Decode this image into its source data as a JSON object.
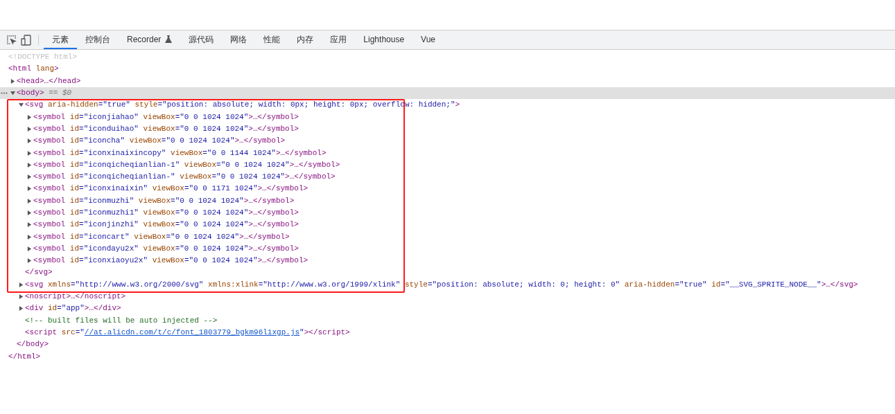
{
  "toolbar": {
    "tabs": [
      {
        "label": "元素",
        "kind": "plain",
        "selected": true
      },
      {
        "label": "控制台",
        "kind": "plain",
        "selected": false
      },
      {
        "label": "Recorder",
        "kind": "experimental",
        "selected": false
      },
      {
        "label": "源代码",
        "kind": "plain",
        "selected": false
      },
      {
        "label": "网络",
        "kind": "plain",
        "selected": false
      },
      {
        "label": "性能",
        "kind": "plain",
        "selected": false
      },
      {
        "label": "内存",
        "kind": "plain",
        "selected": false
      },
      {
        "label": "应用",
        "kind": "plain",
        "selected": false
      },
      {
        "label": "Lighthouse",
        "kind": "plain",
        "selected": false
      },
      {
        "label": "Vue",
        "kind": "plain",
        "selected": false
      }
    ]
  },
  "tree": [
    {
      "selected": false,
      "line": [
        {
          "kind": "doctype",
          "text": "<!DOCTYPE html>"
        }
      ]
    },
    {
      "selected": false,
      "line": [
        {
          "kind": "tag",
          "text": "<html"
        },
        {
          "kind": "attr",
          "text": " lang"
        },
        {
          "kind": "tag",
          "text": ">"
        }
      ],
      "close": [
        {
          "kind": "tag",
          "text": "</html>"
        }
      ],
      "children": [
        {
          "selected": false,
          "expanded": false,
          "line": [
            {
              "kind": "tag",
              "text": "<head>…</head>"
            }
          ]
        },
        {
          "selected": true,
          "expanded": true,
          "line": [
            {
              "kind": "tag",
              "text": "<body>"
            },
            {
              "kind": "ref",
              "text": " == $0"
            }
          ],
          "close": [
            {
              "kind": "tag",
              "text": "</body>"
            }
          ],
          "children": [
            {
              "selected": false,
              "expanded": true,
              "line": [
                {
                  "kind": "tag",
                  "text": "<svg"
                },
                {
                  "kind": "attr",
                  "text": " aria-hidden"
                },
                {
                  "kind": "value",
                  "text": "=\"true\""
                },
                {
                  "kind": "attr",
                  "text": " style"
                },
                {
                  "kind": "value",
                  "text": "=\"position: absolute; width: 0px; height: 0px; overflow: hidden;\""
                },
                {
                  "kind": "tag",
                  "text": ">"
                }
              ],
              "close": [
                {
                  "kind": "tag",
                  "text": "</svg>"
                }
              ],
              "children": [
                {
                  "selected": false,
                  "expanded": false,
                  "line": [
                    {
                      "kind": "tag",
                      "text": "<symbol"
                    },
                    {
                      "kind": "attr",
                      "text": " id"
                    },
                    {
                      "kind": "value",
                      "text": "=\"iconjiahao\""
                    },
                    {
                      "kind": "attr",
                      "text": " viewBox"
                    },
                    {
                      "kind": "value",
                      "text": "=\"0 0 1024 1024\""
                    },
                    {
                      "kind": "tag",
                      "text": ">…</symbol>"
                    }
                  ]
                },
                {
                  "selected": false,
                  "expanded": false,
                  "line": [
                    {
                      "kind": "tag",
                      "text": "<symbol"
                    },
                    {
                      "kind": "attr",
                      "text": " id"
                    },
                    {
                      "kind": "value",
                      "text": "=\"iconduihao\""
                    },
                    {
                      "kind": "attr",
                      "text": " viewBox"
                    },
                    {
                      "kind": "value",
                      "text": "=\"0 0 1024 1024\""
                    },
                    {
                      "kind": "tag",
                      "text": ">…</symbol>"
                    }
                  ]
                },
                {
                  "selected": false,
                  "expanded": false,
                  "line": [
                    {
                      "kind": "tag",
                      "text": "<symbol"
                    },
                    {
                      "kind": "attr",
                      "text": " id"
                    },
                    {
                      "kind": "value",
                      "text": "=\"iconcha\""
                    },
                    {
                      "kind": "attr",
                      "text": " viewBox"
                    },
                    {
                      "kind": "value",
                      "text": "=\"0 0 1024 1024\""
                    },
                    {
                      "kind": "tag",
                      "text": ">…</symbol>"
                    }
                  ]
                },
                {
                  "selected": false,
                  "expanded": false,
                  "line": [
                    {
                      "kind": "tag",
                      "text": "<symbol"
                    },
                    {
                      "kind": "attr",
                      "text": " id"
                    },
                    {
                      "kind": "value",
                      "text": "=\"iconxinaixincopy\""
                    },
                    {
                      "kind": "attr",
                      "text": " viewBox"
                    },
                    {
                      "kind": "value",
                      "text": "=\"0 0 1144 1024\""
                    },
                    {
                      "kind": "tag",
                      "text": ">…</symbol>"
                    }
                  ]
                },
                {
                  "selected": false,
                  "expanded": false,
                  "line": [
                    {
                      "kind": "tag",
                      "text": "<symbol"
                    },
                    {
                      "kind": "attr",
                      "text": " id"
                    },
                    {
                      "kind": "value",
                      "text": "=\"iconqicheqianlian-1\""
                    },
                    {
                      "kind": "attr",
                      "text": " viewBox"
                    },
                    {
                      "kind": "value",
                      "text": "=\"0 0 1024 1024\""
                    },
                    {
                      "kind": "tag",
                      "text": ">…</symbol>"
                    }
                  ]
                },
                {
                  "selected": false,
                  "expanded": false,
                  "line": [
                    {
                      "kind": "tag",
                      "text": "<symbol"
                    },
                    {
                      "kind": "attr",
                      "text": " id"
                    },
                    {
                      "kind": "value",
                      "text": "=\"iconqicheqianlian-\""
                    },
                    {
                      "kind": "attr",
                      "text": " viewBox"
                    },
                    {
                      "kind": "value",
                      "text": "=\"0 0 1024 1024\""
                    },
                    {
                      "kind": "tag",
                      "text": ">…</symbol>"
                    }
                  ]
                },
                {
                  "selected": false,
                  "expanded": false,
                  "line": [
                    {
                      "kind": "tag",
                      "text": "<symbol"
                    },
                    {
                      "kind": "attr",
                      "text": " id"
                    },
                    {
                      "kind": "value",
                      "text": "=\"iconxinaixin\""
                    },
                    {
                      "kind": "attr",
                      "text": " viewBox"
                    },
                    {
                      "kind": "value",
                      "text": "=\"0 0 1171 1024\""
                    },
                    {
                      "kind": "tag",
                      "text": ">…</symbol>"
                    }
                  ]
                },
                {
                  "selected": false,
                  "expanded": false,
                  "line": [
                    {
                      "kind": "tag",
                      "text": "<symbol"
                    },
                    {
                      "kind": "attr",
                      "text": " id"
                    },
                    {
                      "kind": "value",
                      "text": "=\"iconmuzhi\""
                    },
                    {
                      "kind": "attr",
                      "text": " viewBox"
                    },
                    {
                      "kind": "value",
                      "text": "=\"0 0 1024 1024\""
                    },
                    {
                      "kind": "tag",
                      "text": ">…</symbol>"
                    }
                  ]
                },
                {
                  "selected": false,
                  "expanded": false,
                  "line": [
                    {
                      "kind": "tag",
                      "text": "<symbol"
                    },
                    {
                      "kind": "attr",
                      "text": " id"
                    },
                    {
                      "kind": "value",
                      "text": "=\"iconmuzhi1\""
                    },
                    {
                      "kind": "attr",
                      "text": " viewBox"
                    },
                    {
                      "kind": "value",
                      "text": "=\"0 0 1024 1024\""
                    },
                    {
                      "kind": "tag",
                      "text": ">…</symbol>"
                    }
                  ]
                },
                {
                  "selected": false,
                  "expanded": false,
                  "line": [
                    {
                      "kind": "tag",
                      "text": "<symbol"
                    },
                    {
                      "kind": "attr",
                      "text": " id"
                    },
                    {
                      "kind": "value",
                      "text": "=\"iconjinzhi\""
                    },
                    {
                      "kind": "attr",
                      "text": " viewBox"
                    },
                    {
                      "kind": "value",
                      "text": "=\"0 0 1024 1024\""
                    },
                    {
                      "kind": "tag",
                      "text": ">…</symbol>"
                    }
                  ]
                },
                {
                  "selected": false,
                  "expanded": false,
                  "line": [
                    {
                      "kind": "tag",
                      "text": "<symbol"
                    },
                    {
                      "kind": "attr",
                      "text": " id"
                    },
                    {
                      "kind": "value",
                      "text": "=\"iconcart\""
                    },
                    {
                      "kind": "attr",
                      "text": " viewBox"
                    },
                    {
                      "kind": "value",
                      "text": "=\"0 0 1024 1024\""
                    },
                    {
                      "kind": "tag",
                      "text": ">…</symbol>"
                    }
                  ]
                },
                {
                  "selected": false,
                  "expanded": false,
                  "line": [
                    {
                      "kind": "tag",
                      "text": "<symbol"
                    },
                    {
                      "kind": "attr",
                      "text": " id"
                    },
                    {
                      "kind": "value",
                      "text": "=\"icondayu2x\""
                    },
                    {
                      "kind": "attr",
                      "text": " viewBox"
                    },
                    {
                      "kind": "value",
                      "text": "=\"0 0 1024 1024\""
                    },
                    {
                      "kind": "tag",
                      "text": ">…</symbol>"
                    }
                  ]
                },
                {
                  "selected": false,
                  "expanded": false,
                  "line": [
                    {
                      "kind": "tag",
                      "text": "<symbol"
                    },
                    {
                      "kind": "attr",
                      "text": " id"
                    },
                    {
                      "kind": "value",
                      "text": "=\"iconxiaoyu2x\""
                    },
                    {
                      "kind": "attr",
                      "text": " viewBox"
                    },
                    {
                      "kind": "value",
                      "text": "=\"0 0 1024 1024\""
                    },
                    {
                      "kind": "tag",
                      "text": ">…</symbol>"
                    }
                  ]
                }
              ]
            },
            {
              "selected": false,
              "expanded": false,
              "line": [
                {
                  "kind": "tag",
                  "text": "<svg"
                },
                {
                  "kind": "attr",
                  "text": " xmlns"
                },
                {
                  "kind": "value",
                  "text": "=\"http://www.w3.org/2000/svg\""
                },
                {
                  "kind": "attr",
                  "text": " xmlns:xlink"
                },
                {
                  "kind": "value",
                  "text": "=\"http://www.w3.org/1999/xlink\""
                },
                {
                  "kind": "attr",
                  "text": " style"
                },
                {
                  "kind": "value",
                  "text": "=\"position: absolute; width: 0; height: 0\""
                },
                {
                  "kind": "attr",
                  "text": " aria-hidden"
                },
                {
                  "kind": "value",
                  "text": "=\"true\""
                },
                {
                  "kind": "attr",
                  "text": " id"
                },
                {
                  "kind": "value",
                  "text": "=\"__SVG_SPRITE_NODE__\""
                },
                {
                  "kind": "tag",
                  "text": ">…</svg>"
                }
              ]
            },
            {
              "selected": false,
              "expanded": false,
              "line": [
                {
                  "kind": "tag",
                  "text": "<noscript>…</noscript>"
                }
              ]
            },
            {
              "selected": false,
              "expanded": false,
              "line": [
                {
                  "kind": "tag",
                  "text": "<div"
                },
                {
                  "kind": "attr",
                  "text": " id"
                },
                {
                  "kind": "value",
                  "text": "=\"app\""
                },
                {
                  "kind": "tag",
                  "text": ">…</div>"
                }
              ]
            },
            {
              "selected": false,
              "line": [
                {
                  "kind": "comment",
                  "text": "<!-- built files will be auto injected -->"
                }
              ]
            },
            {
              "selected": false,
              "line": [
                {
                  "kind": "tag",
                  "text": "<script"
                },
                {
                  "kind": "attr",
                  "text": " src"
                },
                {
                  "kind": "value",
                  "text": "=\""
                },
                {
                  "kind": "link",
                  "text": "//at.alicdn.com/t/c/font_1803779_bgkm96l1xgp.js"
                },
                {
                  "kind": "value",
                  "text": "\""
                },
                {
                  "kind": "tag",
                  "text": "></script>"
                }
              ]
            }
          ]
        }
      ]
    }
  ]
}
